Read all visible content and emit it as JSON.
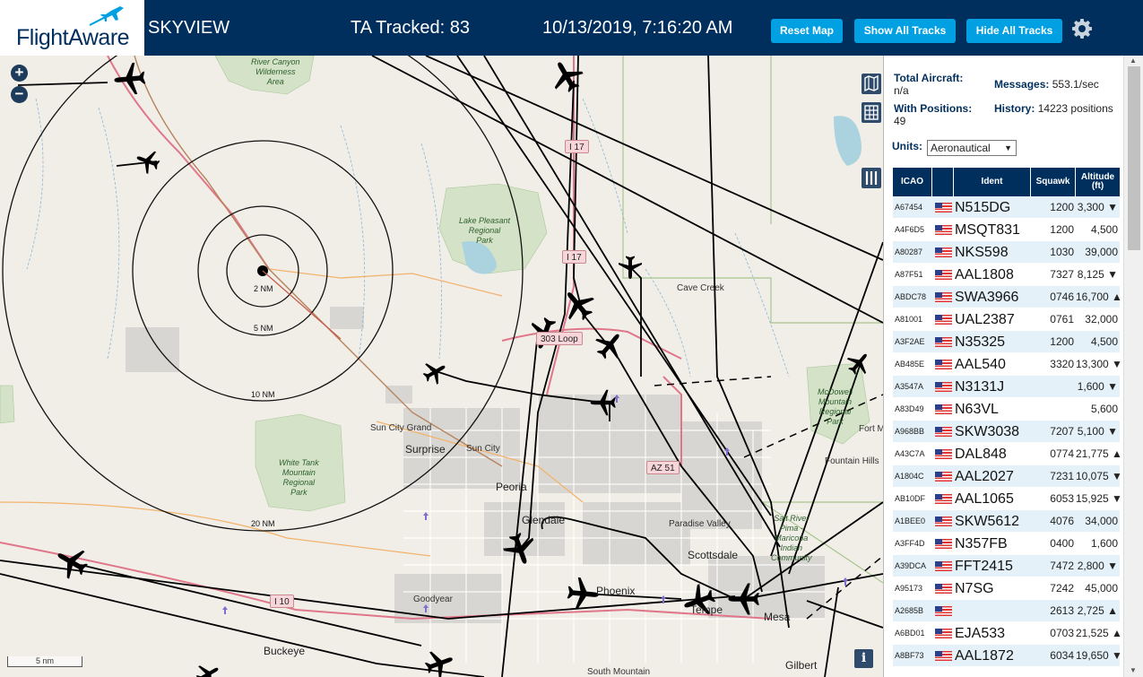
{
  "header": {
    "logo_text": "FlightAware",
    "app_title": "SKYVIEW",
    "tracked": "TA Tracked: 83",
    "clock": "10/13/2019, 7:16:20 AM",
    "buttons": {
      "reset": "Reset Map",
      "show": "Show All Tracks",
      "hide": "Hide All Tracks"
    },
    "accent": "#00a0e2",
    "bar_color": "#002f5d"
  },
  "map": {
    "zoom_in": "+",
    "zoom_out": "−",
    "scale": "5 nm",
    "info": "i",
    "range_rings": [
      "2 NM",
      "5 NM",
      "10 NM",
      "20 NM"
    ],
    "cities": {
      "surprise": "Surprise",
      "sun_city": "Sun City",
      "sun_city_grand": "Sun City Grand",
      "peoria": "Peoria",
      "glendale": "Glendale",
      "phoenix": "Phoenix",
      "scottsdale": "Scottsdale",
      "paradise_valley": "Paradise Valley",
      "tempe": "Tempe",
      "mesa": "Mesa",
      "goodyear": "Goodyear",
      "buckeye": "Buckeye",
      "gilbert": "Gilbert",
      "cave_creek": "Cave Creek",
      "fountain_hills": "Fountain Hills",
      "fort_mc": "Fort M",
      "south_mountain": "South Mountain"
    },
    "parks": {
      "river_canyon": "River Canyon\nWilderness\nArea",
      "lake_pleasant": "Lake Pleasant\nRegional\nPark",
      "white_tank": "White Tank\nMountain\nRegional\nPark",
      "mcdowell": "McDowell\nMountain\nRegional\nPark",
      "salt_river": "Salt River\nPima -\nMaricopa\nIndian\nCommunity"
    },
    "shields": {
      "i17_a": "I 17",
      "i17_b": "I 17",
      "loop": "303 Loop",
      "az51": "AZ 51",
      "i10": "I 10"
    }
  },
  "sidebar": {
    "total_aircraft_label": "Total Aircraft:",
    "total_aircraft_value": "n/a",
    "with_positions_label": "With Positions:",
    "with_positions_value": "49",
    "messages_label": "Messages:",
    "messages_value": "553.1/sec",
    "history_label": "History:",
    "history_value": "14223 positions",
    "units_label": "Units:",
    "units_value": "Aeronautical",
    "table": {
      "headers": [
        "ICAO",
        "",
        "Ident",
        "Squawk",
        "Altitude (ft)"
      ],
      "rows": [
        [
          "A67454",
          "N515DG",
          "1200",
          "3,300 ▼"
        ],
        [
          "A4F6D5",
          "MSQT831",
          "1200",
          "4,500"
        ],
        [
          "A80287",
          "NKS598",
          "1030",
          "39,000"
        ],
        [
          "A87F51",
          "AAL1808",
          "7327",
          "8,125 ▼"
        ],
        [
          "ABDC78",
          "SWA3966",
          "0746",
          "16,700 ▲"
        ],
        [
          "A81001",
          "UAL2387",
          "0761",
          "32,000"
        ],
        [
          "A3F2AE",
          "N35325",
          "1200",
          "4,500"
        ],
        [
          "AB485E",
          "AAL540",
          "3320",
          "13,300 ▼"
        ],
        [
          "A3547A",
          "N3131J",
          "",
          "1,600 ▼"
        ],
        [
          "A83D49",
          "N63VL",
          "",
          "5,600"
        ],
        [
          "A968BB",
          "SKW3038",
          "7207",
          "5,100 ▼"
        ],
        [
          "A43C7A",
          "DAL848",
          "0774",
          "21,775 ▲"
        ],
        [
          "A1804C",
          "AAL2027",
          "7231",
          "10,075 ▼"
        ],
        [
          "AB10DF",
          "AAL1065",
          "6053",
          "15,925 ▼"
        ],
        [
          "A1BEE0",
          "SKW5612",
          "4076",
          "34,000"
        ],
        [
          "A3FF4D",
          "N357FB",
          "0400",
          "1,600"
        ],
        [
          "A39DCA",
          "FFT2415",
          "7472",
          "2,800 ▼"
        ],
        [
          "A95173",
          "N7SG",
          "7242",
          "45,000"
        ],
        [
          "A2685B",
          "",
          "2613",
          "2,725 ▲"
        ],
        [
          "A6BD01",
          "EJA533",
          "0703",
          "21,525 ▲"
        ],
        [
          "A8BF73",
          "AAL1872",
          "6034",
          "19,650 ▼"
        ]
      ]
    }
  }
}
